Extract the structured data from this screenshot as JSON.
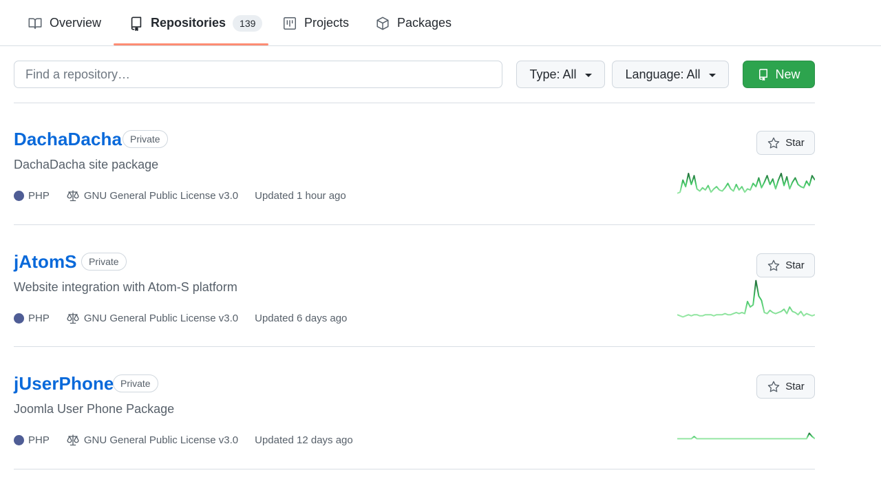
{
  "tabs": [
    {
      "label": "Overview",
      "icon": "book-icon"
    },
    {
      "label": "Repositories",
      "icon": "repo-icon",
      "count": "139",
      "active": true
    },
    {
      "label": "Projects",
      "icon": "project-icon"
    },
    {
      "label": "Packages",
      "icon": "package-icon"
    }
  ],
  "filters": {
    "search_placeholder": "Find a repository…",
    "type_label": "Type: All",
    "language_label": "Language: All",
    "new_label": "New"
  },
  "repos": [
    {
      "name": "DachaDacha",
      "visibility": "Private",
      "description": "DachaDacha site package",
      "language": "PHP",
      "license": "GNU General Public License v3.0",
      "updated": "Updated 1 hour ago",
      "star_label": "Star",
      "activity": [
        2,
        3,
        14,
        8,
        20,
        10,
        18,
        6,
        4,
        7,
        5,
        9,
        3,
        6,
        8,
        5,
        4,
        7,
        11,
        6,
        4,
        10,
        5,
        8,
        3,
        6,
        5,
        11,
        8,
        16,
        7,
        12,
        18,
        10,
        15,
        6,
        14,
        20,
        9,
        17,
        6,
        12,
        16,
        10,
        8,
        7,
        13,
        9,
        18,
        14
      ]
    },
    {
      "name": "jAtomS",
      "visibility": "Private",
      "description": "Website integration with Atom-S platform",
      "language": "PHP",
      "license": "GNU General Public License v3.0",
      "updated": "Updated 6 days ago",
      "star_label": "Star",
      "activity": [
        3,
        2,
        1,
        2,
        3,
        2,
        3,
        3,
        2,
        2,
        3,
        3,
        3,
        2,
        3,
        3,
        3,
        4,
        3,
        3,
        4,
        5,
        4,
        5,
        4,
        15,
        10,
        12,
        34,
        20,
        16,
        5,
        4,
        7,
        5,
        4,
        5,
        6,
        8,
        4,
        10,
        6,
        5,
        3,
        6,
        2,
        4,
        3,
        2,
        3
      ]
    },
    {
      "name": "jUserPhone",
      "visibility": "Private",
      "description": "Joomla User Phone Package",
      "language": "PHP",
      "license": "GNU General Public License v3.0",
      "updated": "Updated 12 days ago",
      "star_label": "Star",
      "activity": [
        1,
        1,
        1,
        1,
        1,
        1,
        3,
        1,
        1,
        1,
        1,
        1,
        1,
        1,
        1,
        1,
        1,
        1,
        1,
        1,
        1,
        1,
        1,
        1,
        1,
        1,
        1,
        1,
        1,
        1,
        1,
        1,
        1,
        1,
        1,
        1,
        1,
        1,
        1,
        1,
        1,
        1,
        1,
        1,
        1,
        1,
        1,
        6,
        3,
        1
      ]
    }
  ],
  "colors": {
    "link": "#0969da",
    "php": "#4F5D95",
    "new_button": "#2da44e",
    "tab_underline": "#fd8c73",
    "sparkline": "#40c463"
  }
}
